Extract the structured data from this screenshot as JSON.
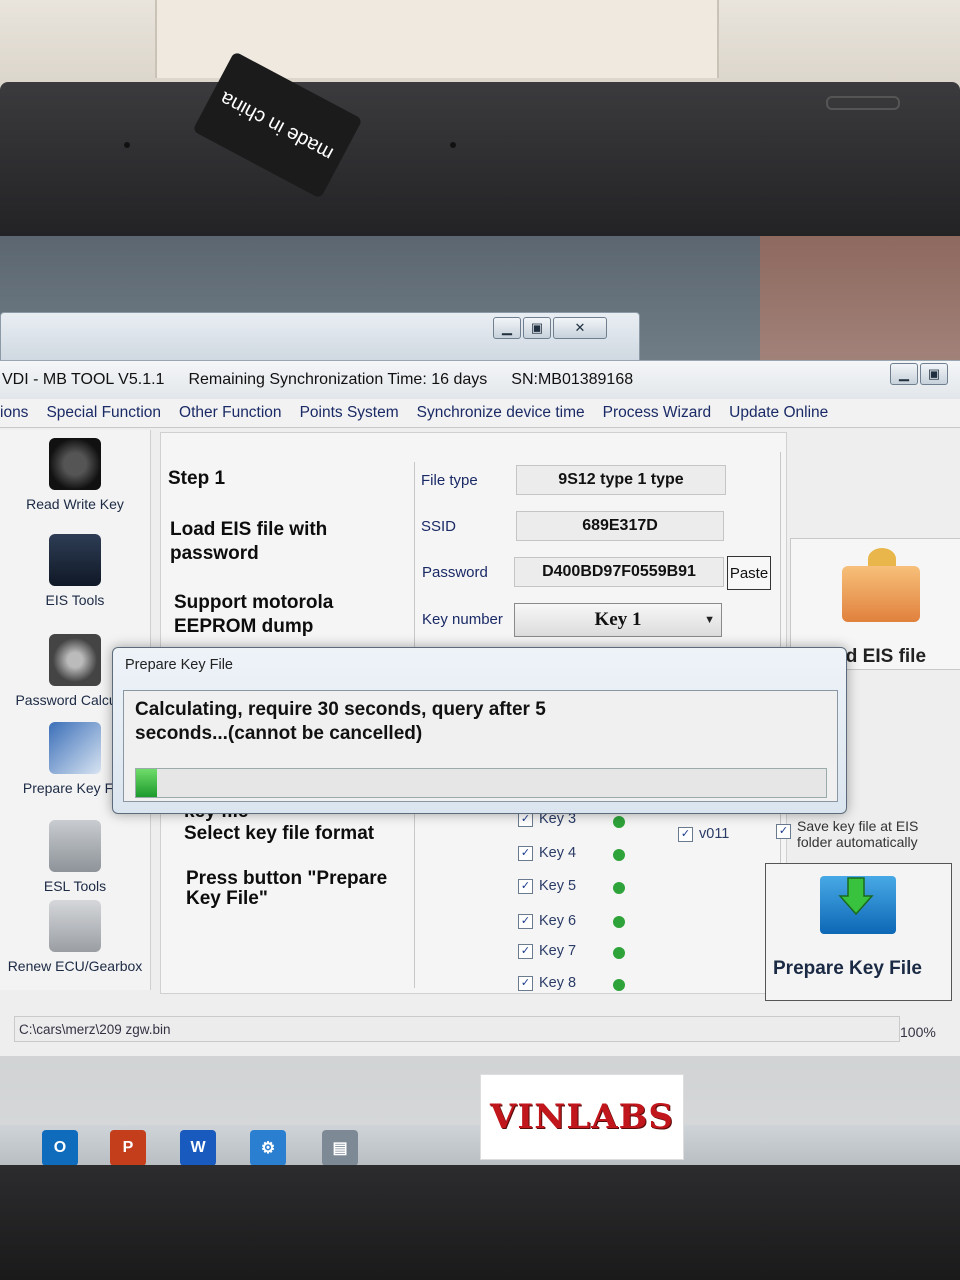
{
  "sticker": {
    "text": "made in china"
  },
  "app": {
    "title": "VDI - MB TOOL V5.1.1",
    "sync_time": "Remaining Synchronization Time: 16 days",
    "serial": "SN:MB01389168"
  },
  "menu": [
    "ions",
    "Special Function",
    "Other Function",
    "Points System",
    "Synchronize device time",
    "Process Wizard",
    "Update Online"
  ],
  "sidebar": [
    {
      "label": "Read Write Key",
      "icon": "key-fob-icon"
    },
    {
      "label": "EIS Tools",
      "icon": "eis-module-icon"
    },
    {
      "label": "Password Calculati",
      "icon": "password-dial-icon"
    },
    {
      "label": "Prepare Key File",
      "icon": "key-file-icon"
    },
    {
      "label": "ESL Tools",
      "icon": "esl-module-icon"
    },
    {
      "label": "Renew ECU/Gearbox",
      "icon": "ecu-module-icon"
    }
  ],
  "steps": {
    "step1_title": "Step 1",
    "step1_line1": "Load EIS file with",
    "step1_line2": "password",
    "step1_line3": "Support motorola",
    "step1_line4": "EEPROM dump",
    "step2_partial": "key file",
    "step2_line1": "Select key file format",
    "step3_line1": "Press button \"Prepare",
    "step3_line2": "Key File\""
  },
  "form": {
    "file_type_label": "File type",
    "file_type_value": "9S12 type 1 type",
    "ssid_label": "SSID",
    "ssid_value": "689E317D",
    "password_label": "Password",
    "password_value": "D400BD97F0559B91",
    "paste_label": "Paste",
    "key_number_label": "Key number",
    "key_number_value": "Key 1"
  },
  "keys": [
    {
      "label": "Key 3",
      "checked": true
    },
    {
      "label": "Key 4",
      "checked": true
    },
    {
      "label": "Key 5",
      "checked": true
    },
    {
      "label": "Key 6",
      "checked": true
    },
    {
      "label": "Key 7",
      "checked": true
    },
    {
      "label": "Key 8",
      "checked": true
    }
  ],
  "format_option": {
    "label": "v011",
    "checked": true
  },
  "right": {
    "load_eis_label": "Load EIS file",
    "save_auto_line1": "Save key file at EIS",
    "save_auto_line2": "folder automatically",
    "prepare_key_file_label": "Prepare Key File"
  },
  "modal": {
    "title": "Prepare Key File",
    "message_line1": "Calculating, require 30 seconds, query after 5",
    "message_line2": "seconds...(cannot be cancelled)",
    "progress": 0.03
  },
  "status": {
    "path": "C:\\cars\\merz\\209 zgw.bin",
    "zoom": "100%"
  },
  "brand": {
    "text": "VINLABS"
  },
  "colors": {
    "accent_green": "#2ea33a",
    "menu_blue": "#1a2a66",
    "brand_red": "#c0161c"
  }
}
